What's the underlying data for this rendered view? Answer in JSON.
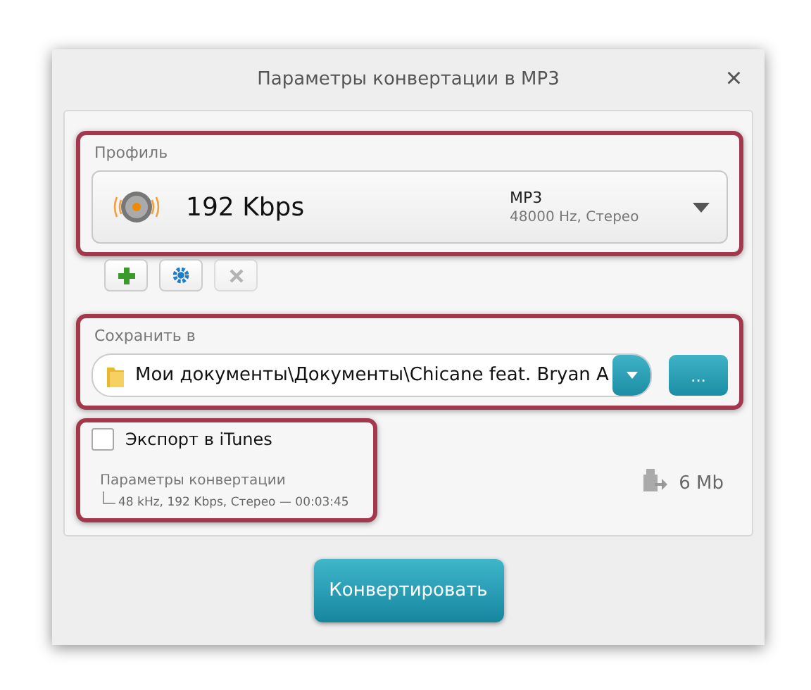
{
  "window": {
    "title": "Параметры конвертации в MP3",
    "close": "×"
  },
  "profile": {
    "label": "Профиль",
    "bitrate": "192 Kbps",
    "format": "MP3",
    "details": "48000 Hz,  Стерео"
  },
  "profile_buttons": [
    {
      "kind": "add",
      "disabled": false
    },
    {
      "kind": "settings",
      "disabled": false
    },
    {
      "kind": "remove",
      "disabled": true
    }
  ],
  "save": {
    "label": "Сохранить в",
    "path": "Мои документы\\Документы\\Chicane feat. Bryan A",
    "browse": "..."
  },
  "itunes": {
    "label": "Экспорт в iTunes",
    "checked": false
  },
  "conversion": {
    "label": "Параметры конвертации",
    "summary": "48 kHz, 192 Kbps, Стерео — 00:03:45"
  },
  "size": "6 Mb",
  "convert_button": "Конвертировать"
}
